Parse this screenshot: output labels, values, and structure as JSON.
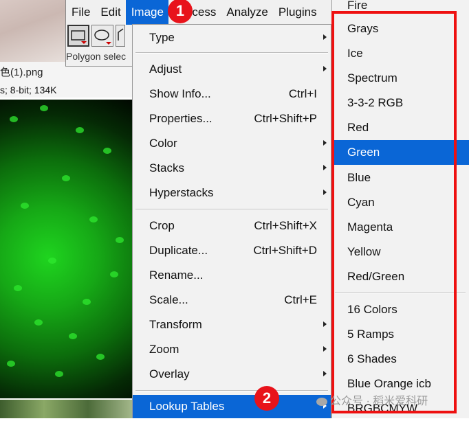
{
  "background_window": {
    "filename": "色(1).png",
    "info": "s; 8-bit; 134K"
  },
  "toolbar": {
    "menus": [
      "File",
      "Edit",
      "Image",
      "Process",
      "Analyze",
      "Plugins"
    ],
    "active_menu": "Image",
    "status": "Polygon selec"
  },
  "image_menu": {
    "items": [
      {
        "label": "Type",
        "shortcut": "",
        "submenu": true
      },
      {
        "label": "Adjust",
        "shortcut": "",
        "submenu": true
      },
      {
        "label": "Show Info...",
        "shortcut": "Ctrl+I",
        "submenu": false
      },
      {
        "label": "Properties...",
        "shortcut": "Ctrl+Shift+P",
        "submenu": false
      },
      {
        "label": "Color",
        "shortcut": "",
        "submenu": true
      },
      {
        "label": "Stacks",
        "shortcut": "",
        "submenu": true
      },
      {
        "label": "Hyperstacks",
        "shortcut": "",
        "submenu": true
      },
      {
        "label": "Crop",
        "shortcut": "Ctrl+Shift+X",
        "submenu": false
      },
      {
        "label": "Duplicate...",
        "shortcut": "Ctrl+Shift+D",
        "submenu": false
      },
      {
        "label": "Rename...",
        "shortcut": "",
        "submenu": false
      },
      {
        "label": "Scale...",
        "shortcut": "Ctrl+E",
        "submenu": false
      },
      {
        "label": "Transform",
        "shortcut": "",
        "submenu": true
      },
      {
        "label": "Zoom",
        "shortcut": "",
        "submenu": true
      },
      {
        "label": "Overlay",
        "shortcut": "",
        "submenu": true
      },
      {
        "label": "Lookup Tables",
        "shortcut": "",
        "submenu": true
      }
    ],
    "highlighted": "Lookup Tables"
  },
  "lookup_tables_menu": {
    "items": [
      "Fire",
      "Grays",
      "Ice",
      "Spectrum",
      "3-3-2 RGB",
      "Red",
      "Green",
      "Blue",
      "Cyan",
      "Magenta",
      "Yellow",
      "Red/Green",
      "16 Colors",
      "5 Ramps",
      "6 Shades",
      "Blue Orange icb",
      "BRGBCMYW"
    ],
    "highlighted": "Green"
  },
  "annotations": {
    "step1": "1",
    "step2": "2",
    "highlight_color": "#ee1111"
  },
  "watermark": "公众号 · 稻米爱科研",
  "colors": {
    "menu_highlight": "#0a66d6",
    "annotation_red": "#e8131b"
  }
}
